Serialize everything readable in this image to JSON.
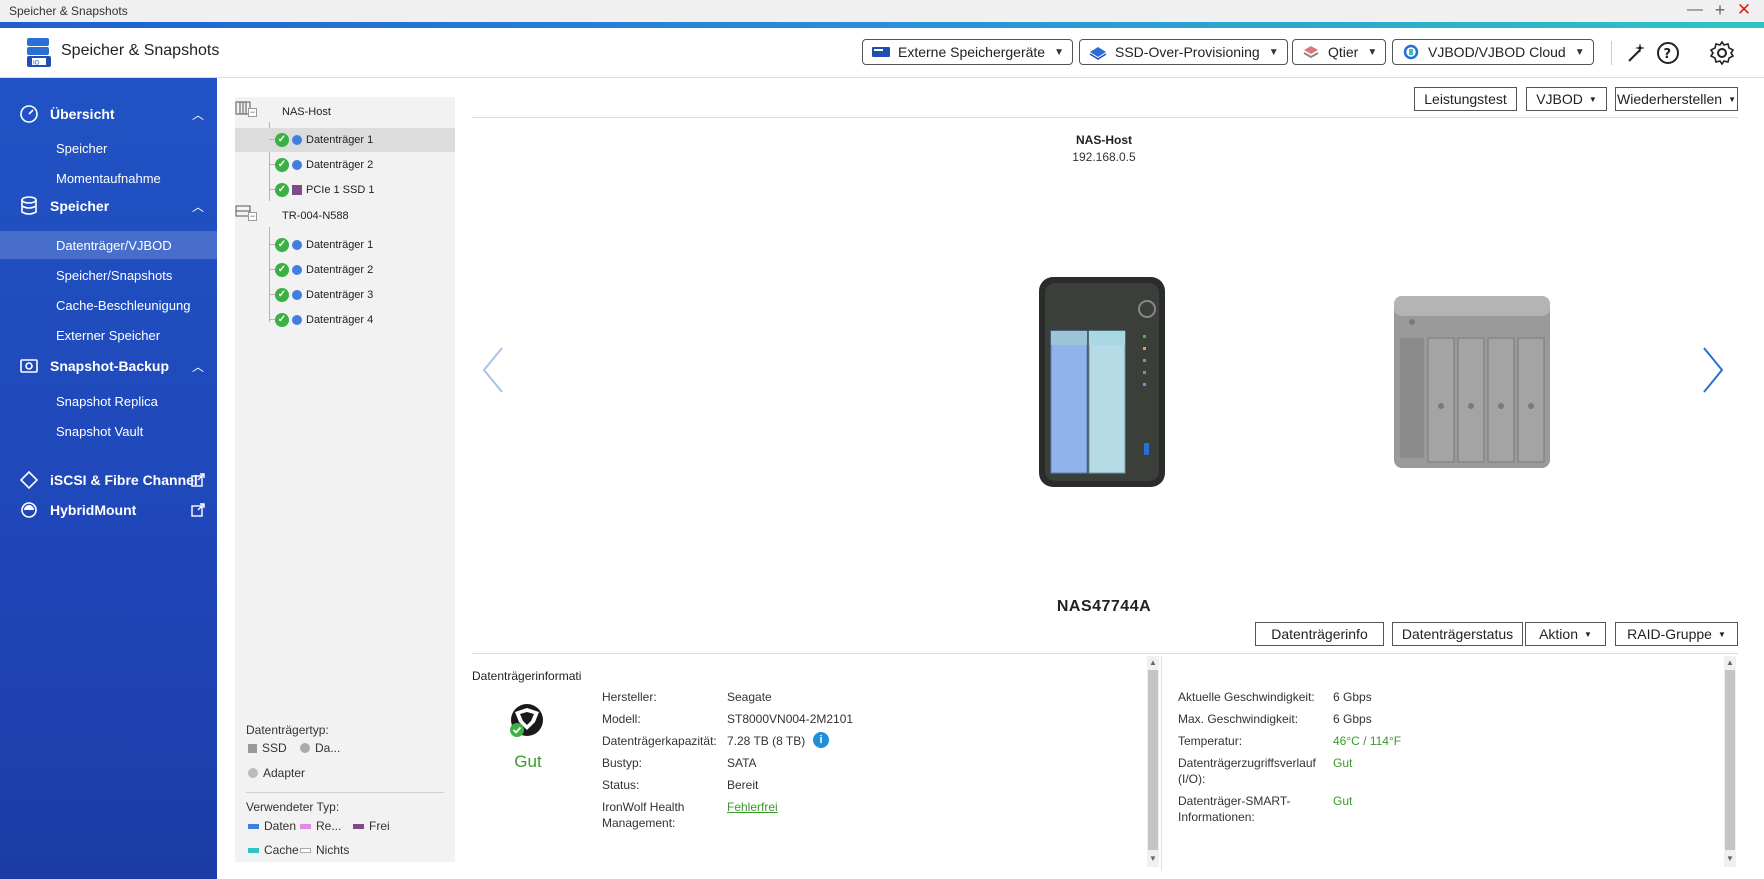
{
  "window": {
    "title": "Speicher & Snapshots"
  },
  "header": {
    "app_title": "Speicher & Snapshots",
    "buttons": [
      {
        "label": "Externe Speichergeräte",
        "icon": "external-storage-icon"
      },
      {
        "label": "SSD-Over-Provisioning",
        "icon": "ssd-icon"
      },
      {
        "label": "Qtier",
        "icon": "qtier-icon"
      },
      {
        "label": "VJBOD/VJBOD Cloud",
        "icon": "vjbod-cloud-icon"
      }
    ],
    "icons": [
      "magic-wand-icon",
      "help-icon",
      "settings-gear-icon"
    ]
  },
  "sidebar": {
    "sections": [
      {
        "label": "Übersicht",
        "icon": "dashboard-icon",
        "items": [
          "Speicher",
          "Momentaufnahme"
        ]
      },
      {
        "label": "Speicher",
        "icon": "database-icon",
        "items": [
          "Datenträger/VJBOD",
          "Speicher/Snapshots",
          "Cache-Beschleunigung",
          "Externer Speicher"
        ]
      },
      {
        "label": "Snapshot-Backup",
        "icon": "snapshot-backup-icon",
        "items": [
          "Snapshot Replica",
          "Snapshot Vault"
        ]
      }
    ],
    "links": [
      {
        "label": "iSCSI & Fibre Channel",
        "icon": "iscsi-icon"
      },
      {
        "label": "HybridMount",
        "icon": "hybridmount-icon"
      }
    ],
    "active_item": "Datenträger/VJBOD"
  },
  "tree": {
    "groups": [
      {
        "label": "NAS-Host",
        "children": [
          "Datenträger 1",
          "Datenträger 2",
          "PCIe 1 SSD 1"
        ]
      },
      {
        "label": "TR-004-N588",
        "children": [
          "Datenträger 1",
          "Datenträger 2",
          "Datenträger 3",
          "Datenträger 4"
        ]
      }
    ],
    "legend": {
      "disk_type_title": "Datenträgertyp:",
      "disk_types": [
        "SSD",
        "Da...",
        "Adapter"
      ],
      "used_type_title": "Verwendeter Typ:",
      "used_types": [
        {
          "label": "Daten",
          "color": "#3f7fe0"
        },
        {
          "label": "Re...",
          "color": "#e08ae0"
        },
        {
          "label": "Frei",
          "color": "#7d4a8a"
        },
        {
          "label": "Cache",
          "color": "#2ec4c4"
        },
        {
          "label": "Nichts",
          "color": "#ffffff"
        }
      ]
    }
  },
  "toolbar_top": [
    "Leistungstest",
    "VJBOD",
    "Wiederherstellen"
  ],
  "enclosure": {
    "name": "NAS-Host",
    "ip": "192.168.0.5",
    "device_name": "NAS47744A"
  },
  "toolbar_bottom": [
    "Datenträgerinfo",
    "Datenträgerstatus",
    "Aktion",
    "RAID-Gruppe"
  ],
  "disk_info": {
    "title": "Datenträgerinformati",
    "health": "Gut",
    "left": [
      {
        "label": "Hersteller:",
        "value": "Seagate"
      },
      {
        "label": "Modell:",
        "value": "ST8000VN004-2M2101"
      },
      {
        "label": "Datenträgerkapazität:",
        "value": "7.28 TB (8 TB)"
      },
      {
        "label": "Bustyp:",
        "value": "SATA"
      },
      {
        "label": "Status:",
        "value": "Bereit"
      },
      {
        "label": "IronWolf Health Management:",
        "value": "Fehlerfrei"
      }
    ],
    "right": [
      {
        "label": "Aktuelle Geschwindigkeit:",
        "value": "6 Gbps"
      },
      {
        "label": "Max. Geschwindigkeit:",
        "value": "6 Gbps"
      },
      {
        "label": "Temperatur:",
        "value": "46°C / 114°F"
      },
      {
        "label": "Datenträgerzugriffsverlauf (I/O):",
        "value": "Gut"
      },
      {
        "label": "Datenträger-SMART-Informationen:",
        "value": "Gut"
      }
    ]
  },
  "colors": {
    "accent": "#2153c4",
    "ok_green": "#3cb043",
    "health_green": "#3a9a2a"
  }
}
